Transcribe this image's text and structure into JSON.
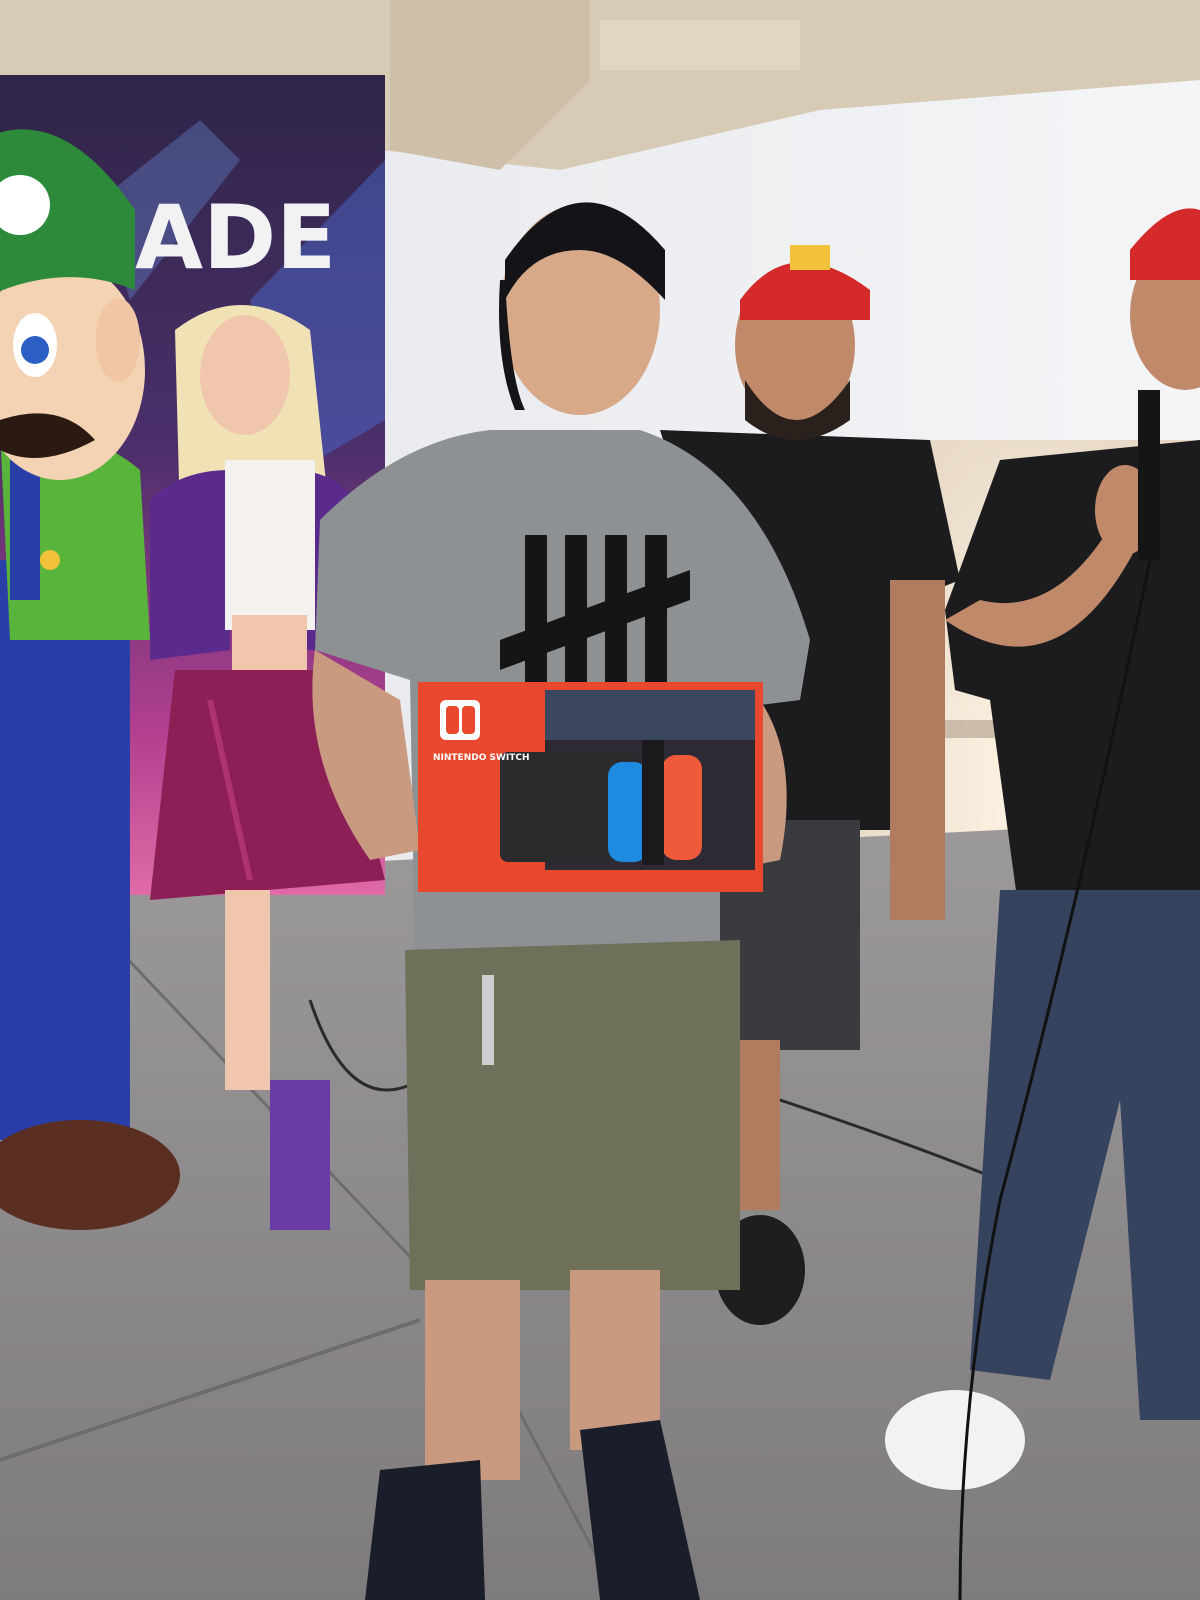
{
  "photo": {
    "backdrop_banner_text": "ADE",
    "box_brand_text": "NINTENDO SWITCH"
  },
  "palette": {
    "ceiling": "#d8cbb6",
    "wall": "#eef0f2",
    "floor": "#8f8c8d",
    "banner_top": "#3a2a52",
    "banner_bottom": "#c2448e",
    "box_red": "#e8492e",
    "joycon_blue": "#1e8be0",
    "joycon_red": "#ef5a3a",
    "mascot_green": "#2c8a3a",
    "mascot_blue": "#2a3ea8",
    "cap_red": "#d42a2a",
    "tee_gray": "#8d9194",
    "shorts_olive": "#6e705a",
    "black_tee": "#1c1c1e"
  }
}
